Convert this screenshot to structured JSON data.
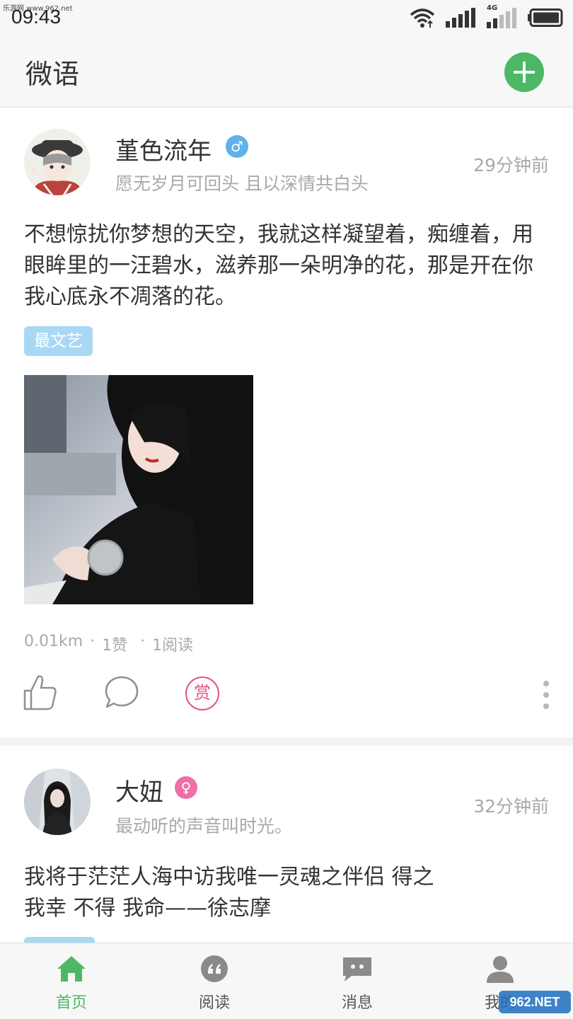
{
  "status_bar": {
    "watermark": "乐游网 www.962.net",
    "time": "09:43",
    "network": "4G",
    "icons": [
      "wifi-icon",
      "signal-icon",
      "signal-4g-icon",
      "battery-icon"
    ]
  },
  "header": {
    "title": "微语",
    "add_icon": "plus-icon"
  },
  "posts": [
    {
      "username": "堇色流年",
      "gender": "male",
      "gender_symbol": "♂",
      "signature": "愿无岁月可回头 且以深情共白头",
      "time": "29分钟前",
      "text": "不想惊扰你梦想的天空，我就这样凝望着，痴缠着，用眼眸里的一汪碧水，滋养那一朵明净的花，那是开在你我心底永不凋落的花。",
      "tag": "最文艺",
      "distance": "0.01km",
      "likes": "1赞",
      "reads": "1阅读",
      "reward_label": "赏"
    },
    {
      "username": "大妞",
      "gender": "female",
      "gender_symbol": "♀",
      "signature": "最动听的声音叫时光。",
      "time": "32分钟前",
      "text": "我将于茫茫人海中访我唯一灵魂之伴侣 得之 我幸 不得 我命——徐志摩"
    }
  ],
  "separator": "·",
  "tabs": [
    {
      "label": "首页",
      "icon": "home-icon",
      "active": true
    },
    {
      "label": "阅读",
      "icon": "quote-icon",
      "active": false
    },
    {
      "label": "消息",
      "icon": "message-icon",
      "active": false
    },
    {
      "label": "我的",
      "icon": "person-icon",
      "active": false
    }
  ],
  "watermark_bottom": "962.NET",
  "colors": {
    "accent_green": "#4cb865",
    "male_blue": "#5fb1ec",
    "female_pink": "#ef6fa6",
    "tag_blue": "#a9d8f5",
    "reward_pink": "#e0548a"
  }
}
